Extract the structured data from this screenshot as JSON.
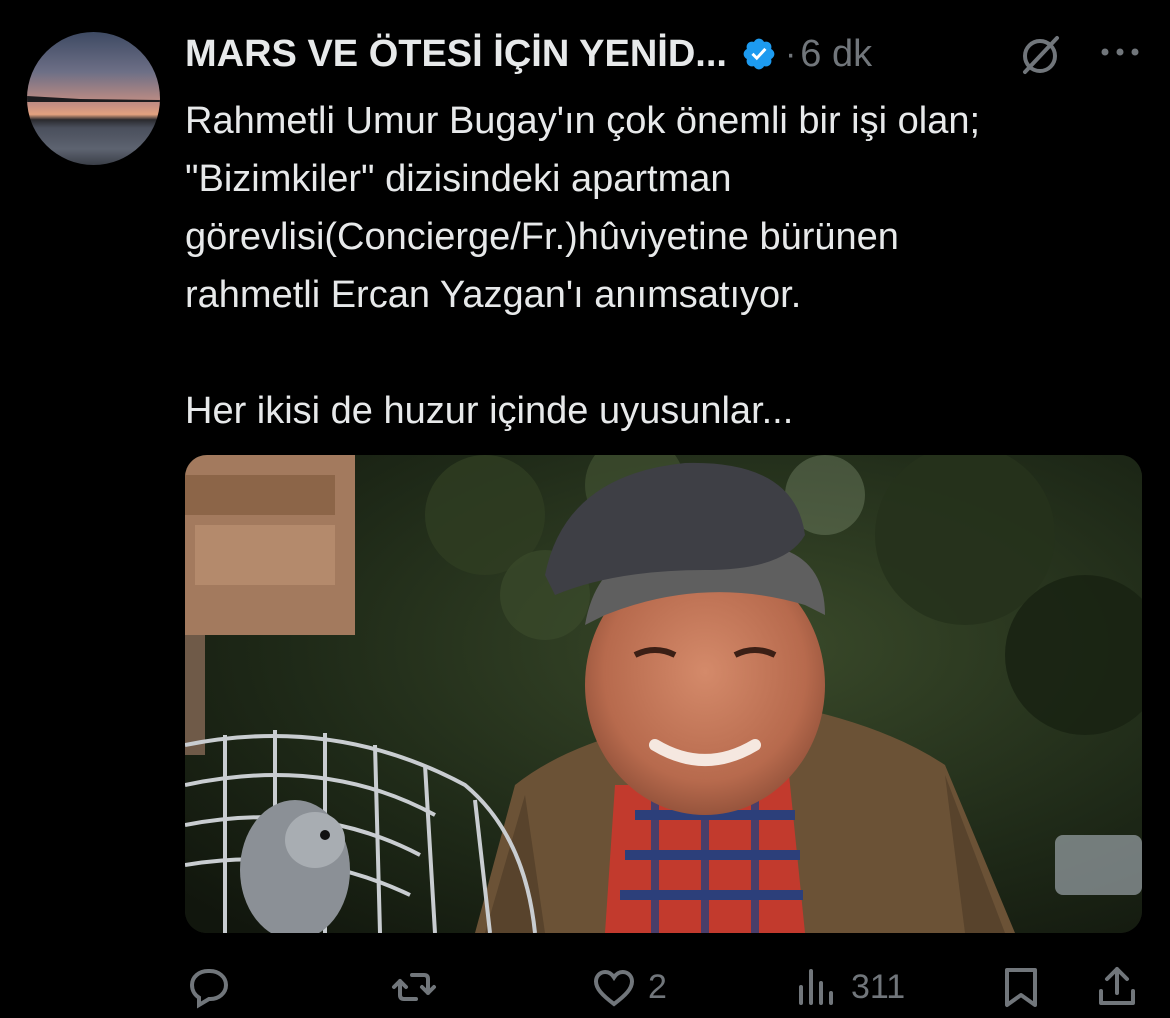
{
  "post": {
    "author_name": "MARS VE ÖTESİ İÇİN YENİD...",
    "separator": "·",
    "time": "6 dk",
    "text": "Rahmetli Umur Bugay'ın çok önemli bir işi olan;\n\"Bizimkiler\" dizisindeki apartman\ngörevlisi(Concierge/Fr.)hûviyetine bürünen\nrahmetli Ercan Yazgan'ı anımsatıyor.\n\nHer ikisi de huzur içinde uyusunlar...",
    "media_icon": "photo-of-smiling-man-with-flat-cap-and-parrot-cage"
  },
  "icons": {
    "verified": "verified-badge-icon",
    "grok": "grok-icon",
    "more": "more-icon",
    "reply": "reply-icon",
    "repost": "repost-icon",
    "like": "heart-icon",
    "views": "views-icon",
    "bookmark": "bookmark-icon",
    "share": "share-icon"
  },
  "actions": {
    "reply_count": "",
    "repost_count": "",
    "like_count": "2",
    "view_count": "311"
  },
  "colors": {
    "background": "#000000",
    "primary_text": "#e7e9ea",
    "secondary_text": "#71767b",
    "verified_blue": "#1d9bf0"
  }
}
